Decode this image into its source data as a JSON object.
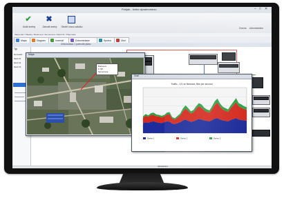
{
  "window": {
    "title": "Pohjak - Iceko dynamomezo",
    "menu_right_1": "Zmena",
    "menu_right_2": "Administrátor"
  },
  "ribbon": {
    "buttons": [
      {
        "label": "Uložit změny",
        "icon": "check-icon"
      },
      {
        "label": "Zahodit změny",
        "icon": "close-icon"
      },
      {
        "label": "Otevřít novou záložku",
        "icon": "window-icon"
      }
    ]
  },
  "breadcrumb": "Mapa sítě / Objekty / Budova A / Serverovna / Rack 01 / Přepínače",
  "tabs": [
    {
      "label": "Mapa",
      "icon": "map-icon",
      "color": "#3b7dd8"
    },
    {
      "label": "Diagram",
      "icon": "diagram-icon",
      "color": "#e07b24"
    },
    {
      "label": "Inventář",
      "icon": "inventory-icon",
      "color": "#4a9a3a"
    },
    {
      "label": "Dokumentace",
      "icon": "document-icon",
      "color": "#7a5bc2"
    },
    {
      "label": "Správa",
      "icon": "settings-icon",
      "color": "#2a8fa8"
    },
    {
      "label": "Úkol",
      "icon": "task-icon",
      "color": "#c23b3b"
    }
  ],
  "subbar_text": "Celá budova, 1 patro dle plánu",
  "left_panel": {
    "header": "Typ",
    "items": [
      "Rozvaděč",
      "Rack 01",
      "Rack 02",
      "Rack 03"
    ]
  },
  "diagram": {
    "device_label": "Server TMM"
  },
  "map_window": {
    "title": "Mapa",
    "popup_lines": [
      "Budova A",
      "2. NP",
      "Serverovna"
    ]
  },
  "chart_window": {
    "title": "Graf"
  },
  "chart_data": {
    "type": "area",
    "title": "Traffic - 1/1 ve Network, Bits per second",
    "x": [
      0,
      1,
      2,
      3,
      4,
      5,
      6,
      7,
      8,
      9,
      10,
      11,
      12,
      13,
      14,
      15,
      16,
      17,
      18,
      19,
      20,
      21,
      22,
      23,
      24,
      25,
      26,
      27,
      28,
      29,
      30,
      31,
      32,
      33,
      34,
      35,
      36,
      37,
      38,
      39
    ],
    "ylim": [
      0,
      100
    ],
    "series": [
      {
        "name": "Series 1",
        "color": "#1d2c9a",
        "values": [
          22,
          24,
          23,
          25,
          26,
          24,
          23,
          22,
          24,
          26,
          25,
          21,
          20,
          22,
          24,
          28,
          30,
          27,
          25,
          26,
          29,
          31,
          30,
          28,
          27,
          26,
          29,
          32,
          33,
          30,
          28,
          27,
          26,
          29,
          31,
          33,
          30,
          29,
          28,
          27
        ]
      },
      {
        "name": "Series 2",
        "color": "#d42a1e",
        "values": [
          12,
          14,
          13,
          15,
          14,
          13,
          14,
          12,
          13,
          15,
          16,
          11,
          10,
          12,
          15,
          20,
          24,
          22,
          18,
          20,
          24,
          28,
          26,
          22,
          20,
          19,
          24,
          30,
          34,
          28,
          24,
          22,
          21,
          26,
          30,
          35,
          29,
          27,
          25,
          24
        ]
      },
      {
        "name": "Series 3",
        "color": "#2fa043",
        "values": [
          3,
          4,
          3,
          4,
          5,
          4,
          3,
          4,
          3,
          4,
          5,
          3,
          3,
          4,
          4,
          6,
          7,
          6,
          5,
          5,
          6,
          7,
          7,
          6,
          5,
          5,
          6,
          8,
          9,
          7,
          6,
          6,
          5,
          6,
          8,
          9,
          7,
          7,
          6,
          6
        ]
      }
    ],
    "grid": true,
    "legend_placement": "bottom"
  },
  "status_text": "Administrátor"
}
